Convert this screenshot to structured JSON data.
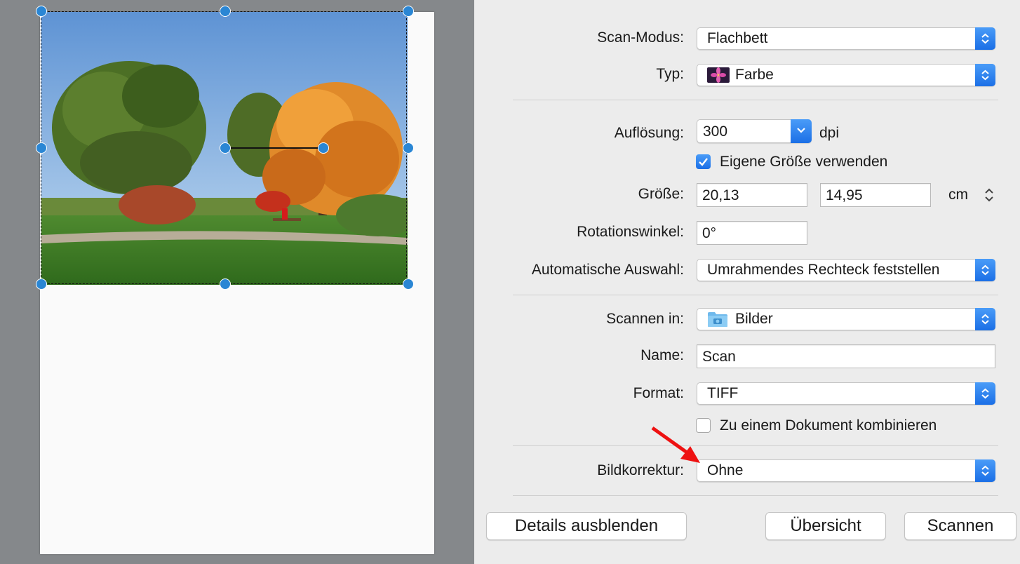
{
  "form": {
    "scan_mode": {
      "label": "Scan-Modus:",
      "value": "Flachbett"
    },
    "type": {
      "label": "Typ:",
      "value": "Farbe",
      "icon": "flower-icon"
    },
    "resolution": {
      "label": "Auflösung:",
      "value": "300",
      "unit": "dpi"
    },
    "custom_size": {
      "label": "Eigene Größe verwenden",
      "checked": true
    },
    "size": {
      "label": "Größe:",
      "width": "20,13",
      "height": "14,95",
      "unit": "cm"
    },
    "rotation": {
      "label": "Rotationswinkel:",
      "value": "0°"
    },
    "auto_select": {
      "label": "Automatische Auswahl:",
      "value": "Umrahmendes Rechteck feststellen"
    },
    "scan_to": {
      "label": "Scannen in:",
      "value": "Bilder",
      "icon": "pictures-folder-icon"
    },
    "name": {
      "label": "Name:",
      "value": "Scan"
    },
    "format": {
      "label": "Format:",
      "value": "TIFF"
    },
    "combine": {
      "label": "Zu einem Dokument kombinieren",
      "checked": false
    },
    "image_correction": {
      "label": "Bildkorrektur:",
      "value": "Ohne"
    }
  },
  "buttons": {
    "hide_details": "Details ausblenden",
    "overview": "Übersicht",
    "scan": "Scannen"
  },
  "colors": {
    "accent": "#2a86d4",
    "annotation_arrow": "#ee1111"
  }
}
